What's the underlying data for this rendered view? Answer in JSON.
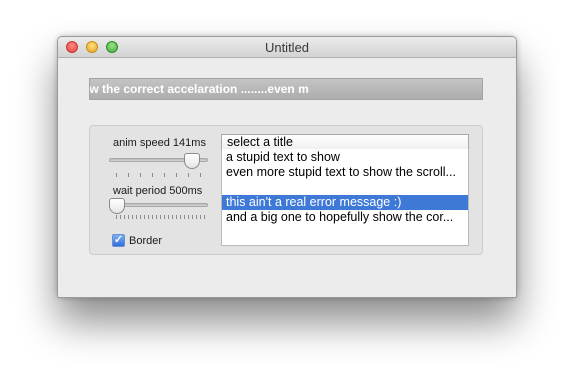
{
  "window": {
    "title": "Untitled"
  },
  "titlebar": {
    "buttons": [
      "close",
      "minimize",
      "zoom"
    ]
  },
  "marquee": {
    "text": "ow the correct accelaration ........even m"
  },
  "controls": {
    "anim_speed_label": "anim speed 141ms",
    "anim_speed_level": 0.9,
    "wait_period_label": "wait period 500ms",
    "wait_period_level": 0.0,
    "border_label": "Border",
    "border_checked": true,
    "border_check_glyph": "✓"
  },
  "combo": {
    "selected": "select a title"
  },
  "list": {
    "items": [
      "a stupid text to show",
      "even more stupid text to show the scroll...",
      "",
      "this ain't a real error message :)",
      "and a big one to hopefully show the cor..."
    ],
    "selected_index": 3
  }
}
